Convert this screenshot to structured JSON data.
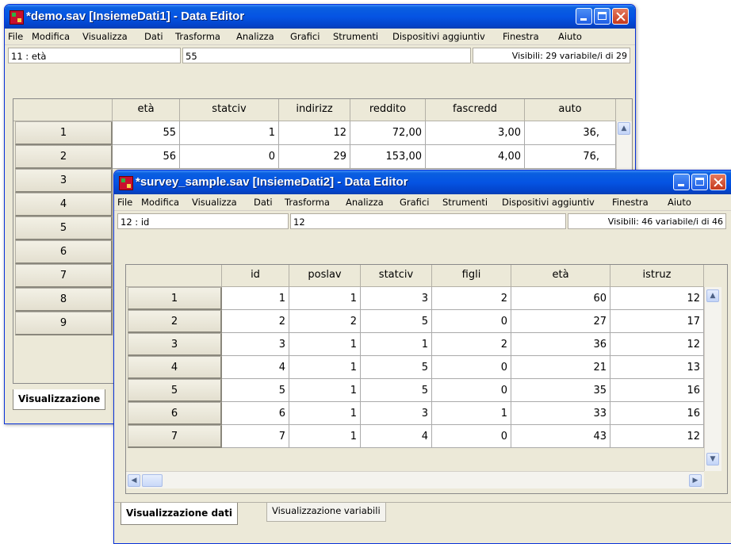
{
  "back_window": {
    "title": "*demo.sav [InsiemeDati1] - Data Editor",
    "menu": [
      "File",
      "Modifica",
      "Visualizza",
      "Dati",
      "Trasforma",
      "Analizza",
      "Grafici",
      "Strumenti",
      "Dispositivi aggiuntiv",
      "Finestra",
      "Aiuto"
    ],
    "cell_ref": "11 : età",
    "cell_value": "55",
    "visible_vars": "Visibili: 29 variabile/i di 29",
    "columns": [
      "età",
      "statciv",
      "indirizz",
      "reddito",
      "fascredd",
      "auto"
    ],
    "row_numbers": [
      "1",
      "2",
      "3",
      "4",
      "5",
      "6",
      "7",
      "8",
      "9"
    ],
    "rows": [
      [
        "55",
        "1",
        "12",
        "72,00",
        "3,00",
        "36,"
      ],
      [
        "56",
        "0",
        "29",
        "153,00",
        "4,00",
        "76,"
      ]
    ],
    "tab_active": "Visualizzazione"
  },
  "front_window": {
    "title": "*survey_sample.sav [InsiemeDati2] - Data Editor",
    "menu": [
      "File",
      "Modifica",
      "Visualizza",
      "Dati",
      "Trasforma",
      "Analizza",
      "Grafici",
      "Strumenti",
      "Dispositivi aggiuntiv",
      "Finestra",
      "Aiuto"
    ],
    "cell_ref": "12 : id",
    "cell_value": "12",
    "visible_vars": "Visibili: 46 variabile/i di 46",
    "columns": [
      "id",
      "poslav",
      "statciv",
      "figli",
      "età",
      "istruz"
    ],
    "row_numbers": [
      "1",
      "2",
      "3",
      "4",
      "5",
      "6",
      "7"
    ],
    "rows": [
      [
        "1",
        "1",
        "3",
        "2",
        "60",
        "12"
      ],
      [
        "2",
        "2",
        "5",
        "0",
        "27",
        "17"
      ],
      [
        "3",
        "1",
        "1",
        "2",
        "36",
        "12"
      ],
      [
        "4",
        "1",
        "5",
        "0",
        "21",
        "13"
      ],
      [
        "5",
        "1",
        "5",
        "0",
        "35",
        "16"
      ],
      [
        "6",
        "1",
        "3",
        "1",
        "33",
        "16"
      ],
      [
        "7",
        "1",
        "4",
        "0",
        "43",
        "12"
      ]
    ],
    "tab_active": "Visualizzazione dati",
    "tab_inactive": "Visualizzazione variabili"
  }
}
